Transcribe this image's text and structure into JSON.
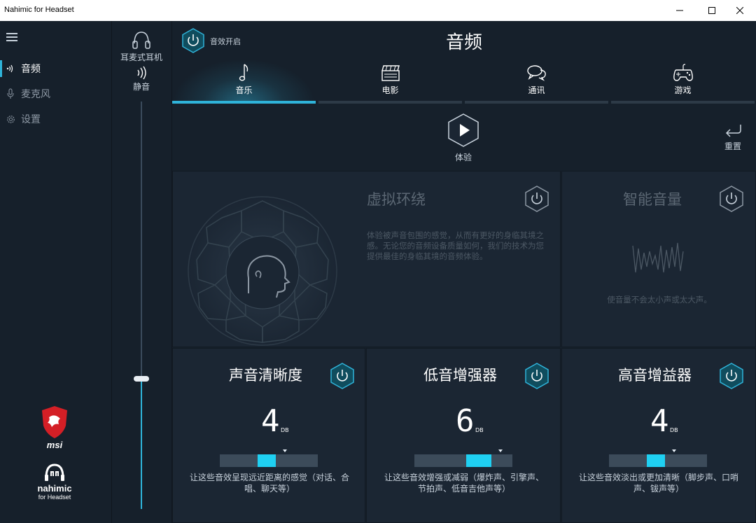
{
  "window": {
    "title": "Nahimic for Headset",
    "minimize_label": "minimize",
    "maximize_label": "maximize",
    "close_label": "close"
  },
  "nav": {
    "items": [
      {
        "label": "音频",
        "icon": "audio-wave-icon",
        "active": true
      },
      {
        "label": "麦克风",
        "icon": "microphone-icon",
        "active": false
      },
      {
        "label": "设置",
        "icon": "gear-icon",
        "active": false
      }
    ],
    "brand_msi": "msi",
    "brand_nahimic": "nahimic",
    "brand_sub": "for Headset"
  },
  "device": {
    "label": "耳麦式耳机",
    "mute_label": "静音",
    "volume_fraction": 0.32
  },
  "header": {
    "power_label": "音效开启",
    "title": "音频"
  },
  "tabs": [
    {
      "label": "音乐",
      "icon": "music-note-icon",
      "active": true
    },
    {
      "label": "电影",
      "icon": "clapperboard-icon",
      "active": false
    },
    {
      "label": "通讯",
      "icon": "chat-bubbles-icon",
      "active": false
    },
    {
      "label": "游戏",
      "icon": "gamepad-icon",
      "active": false
    }
  ],
  "actions": {
    "play_label": "体验",
    "reset_label": "重置"
  },
  "panels": {
    "surround": {
      "title": "虚拟环绕",
      "desc": "体验被声音包围的感觉，从而有更好的身临其境之感。无论您的音频设备质量如何，我们的技术为您提供最佳的身临其境的音频体验。"
    },
    "smart_volume": {
      "title": "智能音量",
      "desc": "使音量不会太小声或太大声。"
    },
    "clarity": {
      "title": "声音清晰度",
      "value": "4",
      "unit": "DB",
      "level": 0.36,
      "desc": "让这些音效呈现远近距离的感觉（对话、合唱、聊天等）"
    },
    "bass": {
      "title": "低音增强器",
      "value": "6",
      "unit": "DB",
      "level": 0.5,
      "desc": "让这些音效增强或减弱（爆炸声、引擎声、节拍声、低音吉他声等）"
    },
    "treble": {
      "title": "高音增益器",
      "value": "4",
      "unit": "DB",
      "level": 0.36,
      "desc": "让这些音效淡出或更加清晰（脚步声、口哨声、钹声等）"
    }
  },
  "colors": {
    "accent": "#2fb3d9",
    "slider_fill": "#1fd0f2",
    "background": "#16202b",
    "panel": "#1b2633"
  }
}
